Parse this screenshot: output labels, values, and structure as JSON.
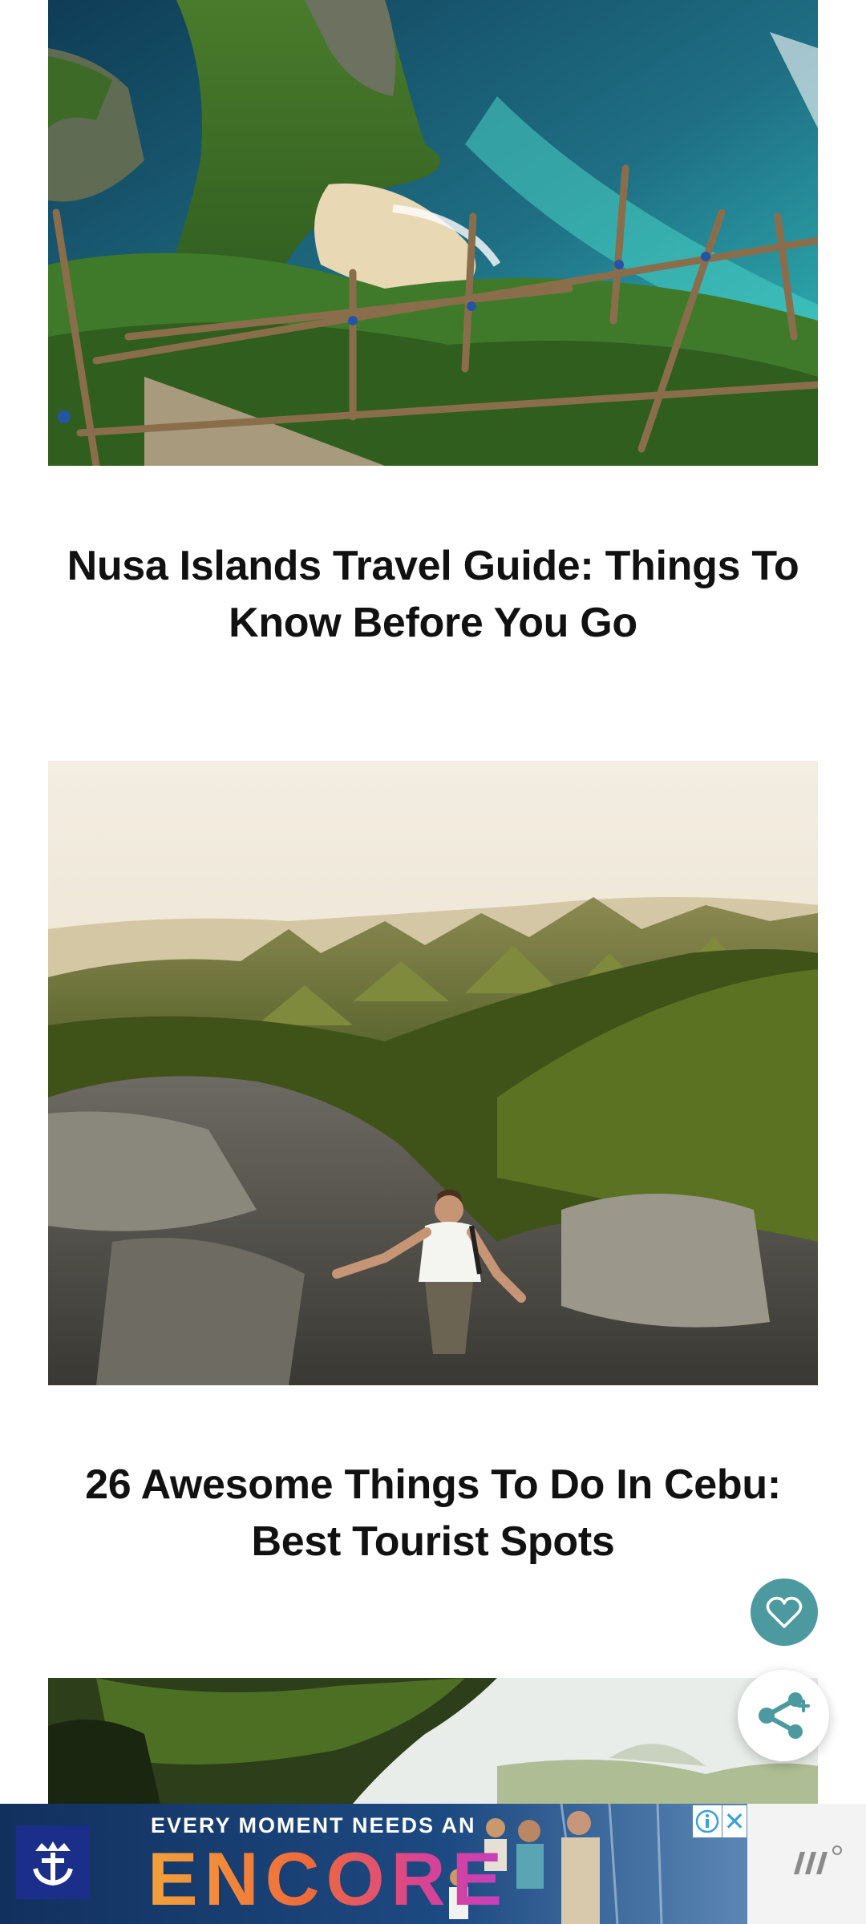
{
  "articles": [
    {
      "title": "Nusa Islands Travel Guide: Things To Know Before You Go",
      "image_icon": "coastal-cliff-photo"
    },
    {
      "title": "26 Awesome Things To Do In Cebu: Best Tourist Spots",
      "image_icon": "hiker-hills-photo"
    },
    {
      "title": "",
      "image_icon": "jungle-trail-photo"
    }
  ],
  "floating_actions": {
    "favorite_icon": "heart-icon",
    "share_icon": "share-icon",
    "favorite_color": "#4c9aa0"
  },
  "ad": {
    "tagline": "EVERY MOMENT NEEDS AN",
    "headline": "ENCORE",
    "brand_icon": "cruise-crown-anchor-logo",
    "info_icon": "info-icon",
    "close_label": "✕",
    "network_icon": "ad-network-logo"
  }
}
